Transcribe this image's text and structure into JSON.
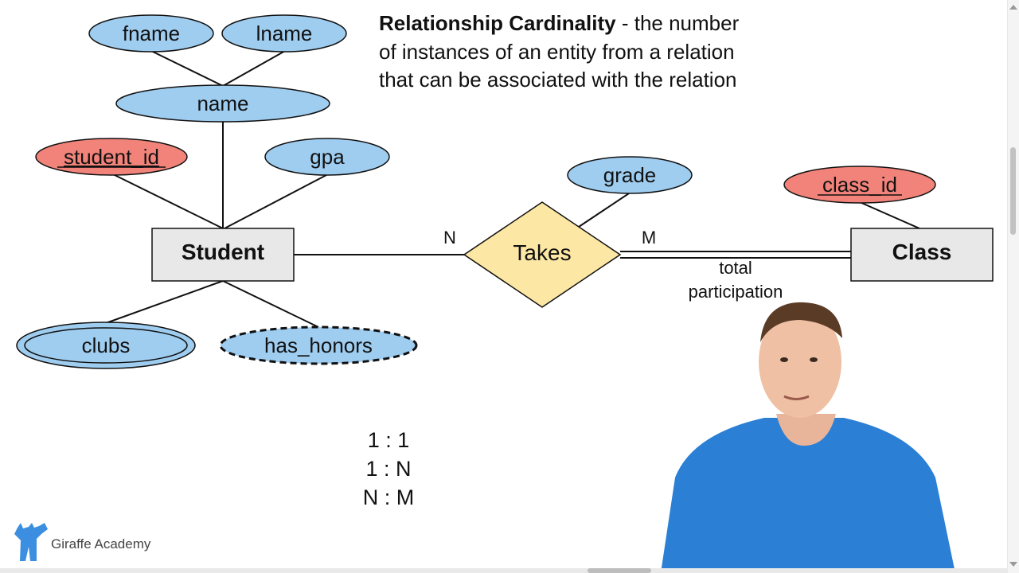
{
  "heading": {
    "bold": "Relationship Cardinality",
    "rest": " - the number of instances of an entity from a relation that can be associated with the relation"
  },
  "entities": {
    "student": "Student",
    "class": "Class"
  },
  "relationship": {
    "label": "Takes"
  },
  "attributes": {
    "fname": "fname",
    "lname": "lname",
    "name": "name",
    "student_id": "student_id",
    "gpa": "gpa",
    "grade": "grade",
    "class_id": "class_id",
    "clubs": "clubs",
    "has_honors": "has_honors"
  },
  "cardinality": {
    "left": "N",
    "right": "M"
  },
  "annotation": {
    "line1": "total",
    "line2": "participation"
  },
  "ratios": [
    "1 : 1",
    "1 : N",
    "N : M"
  ],
  "logo": {
    "text": "Giraffe Academy"
  },
  "colors": {
    "attribute": "#9fcdf0",
    "key_attribute": "#f2837a",
    "entity": "#e8e8e8",
    "relationship": "#fde7a4",
    "stroke": "#111111"
  }
}
